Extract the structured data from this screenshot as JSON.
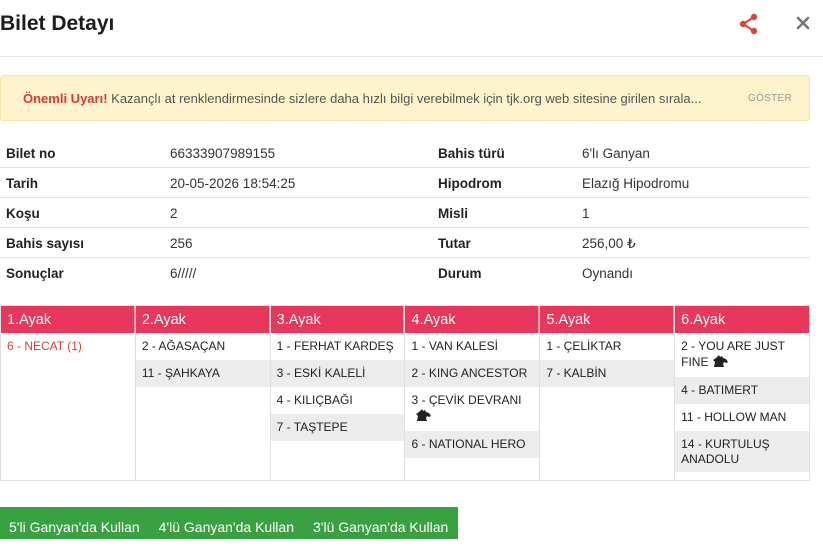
{
  "header": {
    "title": "Bilet Detayı"
  },
  "alert": {
    "strong": "Önemli Uyarı!",
    "message": "Kazançlı at renklendirmesinde sizlere daha hızlı bilgi verebilmek için tjk.org web sitesine girilen sırala...",
    "show_label": "GÖSTER"
  },
  "info": {
    "rows": [
      {
        "l1": "Bilet no",
        "v1": "66333907989155",
        "l2": "Bahis türü",
        "v2": "6'lı Ganyan"
      },
      {
        "l1": "Tarih",
        "v1": "20-05-2026 18:54:25",
        "l2": "Hipodrom",
        "v2": "Elazığ Hipodromu"
      },
      {
        "l1": "Koşu",
        "v1": "2",
        "l2": "Misli",
        "v2": "1"
      },
      {
        "l1": "Bahis sayısı",
        "v1": "256",
        "l2": "Tutar",
        "v2": "256,00 ₺"
      },
      {
        "l1": "Sonuçlar",
        "v1": "6/////",
        "l2": "Durum",
        "v2": "Oynandı"
      }
    ]
  },
  "legs": [
    {
      "title": "1.Ayak",
      "horses": [
        {
          "name": "6 - NECAT (1)",
          "red": true
        }
      ]
    },
    {
      "title": "2.Ayak",
      "horses": [
        {
          "name": "2 - AĞASAÇAN"
        },
        {
          "name": "11 - ŞAHKAYA"
        }
      ]
    },
    {
      "title": "3.Ayak",
      "horses": [
        {
          "name": "1 - FERHAT KARDEŞ"
        },
        {
          "name": "3 - ESKİ KALELİ"
        },
        {
          "name": "4 - KILIÇBAĞI"
        },
        {
          "name": "7 - TAŞTEPE"
        }
      ]
    },
    {
      "title": "4.Ayak",
      "horses": [
        {
          "name": "1 - VAN KALESİ"
        },
        {
          "name": "2 - KING ANCESTOR"
        },
        {
          "name": "3 - ÇEVİK DEVRANI",
          "icon": "horse-head-icon"
        },
        {
          "name": "6 - NATIONAL HERO"
        }
      ]
    },
    {
      "title": "5.Ayak",
      "horses": [
        {
          "name": "1 - ÇELİKTAR"
        },
        {
          "name": "7 - KALBİN"
        }
      ]
    },
    {
      "title": "6.Ayak",
      "horses": [
        {
          "name": "2 - YOU ARE JUST FINE",
          "icon": "horse-head-icon"
        },
        {
          "name": "4 - BATIMERT"
        },
        {
          "name": "11 - HOLLOW MAN"
        },
        {
          "name": "14 - KURTULUŞ ANADOLU"
        }
      ]
    }
  ],
  "buttons": [
    "5'li Ganyan'da Kullan",
    "4'lü Ganyan'da Kullan",
    "3'lü Ganyan'da Kullan"
  ],
  "colors": {
    "accent": "#e8375a",
    "button": "#3aa142",
    "alert_bg": "#fdf3cd",
    "warning_red": "#d63a3a"
  }
}
